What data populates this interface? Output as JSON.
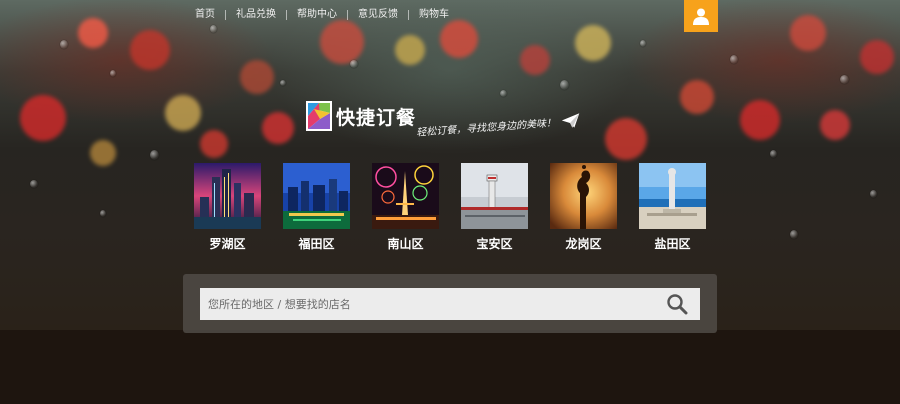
{
  "nav": {
    "items": [
      {
        "label": "首页"
      },
      {
        "label": "礼品兑换"
      },
      {
        "label": "帮助中心"
      },
      {
        "label": "意见反馈"
      },
      {
        "label": "购物车"
      }
    ]
  },
  "user": {
    "icon": "user-icon"
  },
  "brand": {
    "logo_text": "快捷订餐",
    "slogan": "轻松订餐，寻找您身边的美味！",
    "slogan_icon": "paper-plane-icon"
  },
  "districts": [
    {
      "name": "罗湖区",
      "thumb": "city-skyline-night"
    },
    {
      "name": "福田区",
      "thumb": "city-skyline-blue"
    },
    {
      "name": "南山区",
      "thumb": "fireworks-tower"
    },
    {
      "name": "宝安区",
      "thumb": "airport-tower"
    },
    {
      "name": "龙岗区",
      "thumb": "sunset-sculpture"
    },
    {
      "name": "盐田区",
      "thumb": "seaside-statue"
    }
  ],
  "search": {
    "placeholder": "您所在的地区 / 想要找的店名",
    "button_icon": "search-icon"
  },
  "colors": {
    "accent": "#f7a21b",
    "search_bg": "#ececec",
    "panel_bg": "#504b46"
  }
}
